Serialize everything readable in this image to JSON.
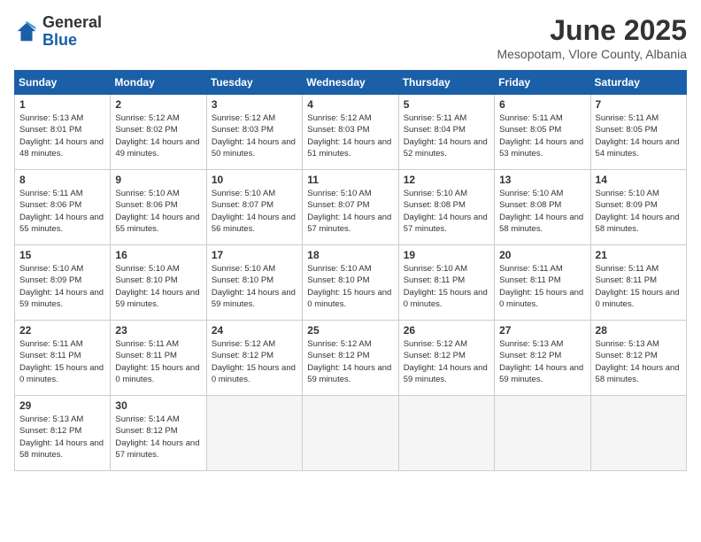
{
  "header": {
    "logo_general": "General",
    "logo_blue": "Blue",
    "month_title": "June 2025",
    "location": "Mesopotam, Vlore County, Albania"
  },
  "days_of_week": [
    "Sunday",
    "Monday",
    "Tuesday",
    "Wednesday",
    "Thursday",
    "Friday",
    "Saturday"
  ],
  "weeks": [
    [
      {
        "day": 1,
        "sunrise": "5:13 AM",
        "sunset": "8:01 PM",
        "daylight": "14 hours and 48 minutes."
      },
      {
        "day": 2,
        "sunrise": "5:12 AM",
        "sunset": "8:02 PM",
        "daylight": "14 hours and 49 minutes."
      },
      {
        "day": 3,
        "sunrise": "5:12 AM",
        "sunset": "8:03 PM",
        "daylight": "14 hours and 50 minutes."
      },
      {
        "day": 4,
        "sunrise": "5:12 AM",
        "sunset": "8:03 PM",
        "daylight": "14 hours and 51 minutes."
      },
      {
        "day": 5,
        "sunrise": "5:11 AM",
        "sunset": "8:04 PM",
        "daylight": "14 hours and 52 minutes."
      },
      {
        "day": 6,
        "sunrise": "5:11 AM",
        "sunset": "8:05 PM",
        "daylight": "14 hours and 53 minutes."
      },
      {
        "day": 7,
        "sunrise": "5:11 AM",
        "sunset": "8:05 PM",
        "daylight": "14 hours and 54 minutes."
      }
    ],
    [
      {
        "day": 8,
        "sunrise": "5:11 AM",
        "sunset": "8:06 PM",
        "daylight": "14 hours and 55 minutes."
      },
      {
        "day": 9,
        "sunrise": "5:10 AM",
        "sunset": "8:06 PM",
        "daylight": "14 hours and 55 minutes."
      },
      {
        "day": 10,
        "sunrise": "5:10 AM",
        "sunset": "8:07 PM",
        "daylight": "14 hours and 56 minutes."
      },
      {
        "day": 11,
        "sunrise": "5:10 AM",
        "sunset": "8:07 PM",
        "daylight": "14 hours and 57 minutes."
      },
      {
        "day": 12,
        "sunrise": "5:10 AM",
        "sunset": "8:08 PM",
        "daylight": "14 hours and 57 minutes."
      },
      {
        "day": 13,
        "sunrise": "5:10 AM",
        "sunset": "8:08 PM",
        "daylight": "14 hours and 58 minutes."
      },
      {
        "day": 14,
        "sunrise": "5:10 AM",
        "sunset": "8:09 PM",
        "daylight": "14 hours and 58 minutes."
      }
    ],
    [
      {
        "day": 15,
        "sunrise": "5:10 AM",
        "sunset": "8:09 PM",
        "daylight": "14 hours and 59 minutes."
      },
      {
        "day": 16,
        "sunrise": "5:10 AM",
        "sunset": "8:10 PM",
        "daylight": "14 hours and 59 minutes."
      },
      {
        "day": 17,
        "sunrise": "5:10 AM",
        "sunset": "8:10 PM",
        "daylight": "14 hours and 59 minutes."
      },
      {
        "day": 18,
        "sunrise": "5:10 AM",
        "sunset": "8:10 PM",
        "daylight": "15 hours and 0 minutes."
      },
      {
        "day": 19,
        "sunrise": "5:10 AM",
        "sunset": "8:11 PM",
        "daylight": "15 hours and 0 minutes."
      },
      {
        "day": 20,
        "sunrise": "5:11 AM",
        "sunset": "8:11 PM",
        "daylight": "15 hours and 0 minutes."
      },
      {
        "day": 21,
        "sunrise": "5:11 AM",
        "sunset": "8:11 PM",
        "daylight": "15 hours and 0 minutes."
      }
    ],
    [
      {
        "day": 22,
        "sunrise": "5:11 AM",
        "sunset": "8:11 PM",
        "daylight": "15 hours and 0 minutes."
      },
      {
        "day": 23,
        "sunrise": "5:11 AM",
        "sunset": "8:11 PM",
        "daylight": "15 hours and 0 minutes."
      },
      {
        "day": 24,
        "sunrise": "5:12 AM",
        "sunset": "8:12 PM",
        "daylight": "15 hours and 0 minutes."
      },
      {
        "day": 25,
        "sunrise": "5:12 AM",
        "sunset": "8:12 PM",
        "daylight": "14 hours and 59 minutes."
      },
      {
        "day": 26,
        "sunrise": "5:12 AM",
        "sunset": "8:12 PM",
        "daylight": "14 hours and 59 minutes."
      },
      {
        "day": 27,
        "sunrise": "5:13 AM",
        "sunset": "8:12 PM",
        "daylight": "14 hours and 59 minutes."
      },
      {
        "day": 28,
        "sunrise": "5:13 AM",
        "sunset": "8:12 PM",
        "daylight": "14 hours and 58 minutes."
      }
    ],
    [
      {
        "day": 29,
        "sunrise": "5:13 AM",
        "sunset": "8:12 PM",
        "daylight": "14 hours and 58 minutes."
      },
      {
        "day": 30,
        "sunrise": "5:14 AM",
        "sunset": "8:12 PM",
        "daylight": "14 hours and 57 minutes."
      },
      null,
      null,
      null,
      null,
      null
    ]
  ]
}
